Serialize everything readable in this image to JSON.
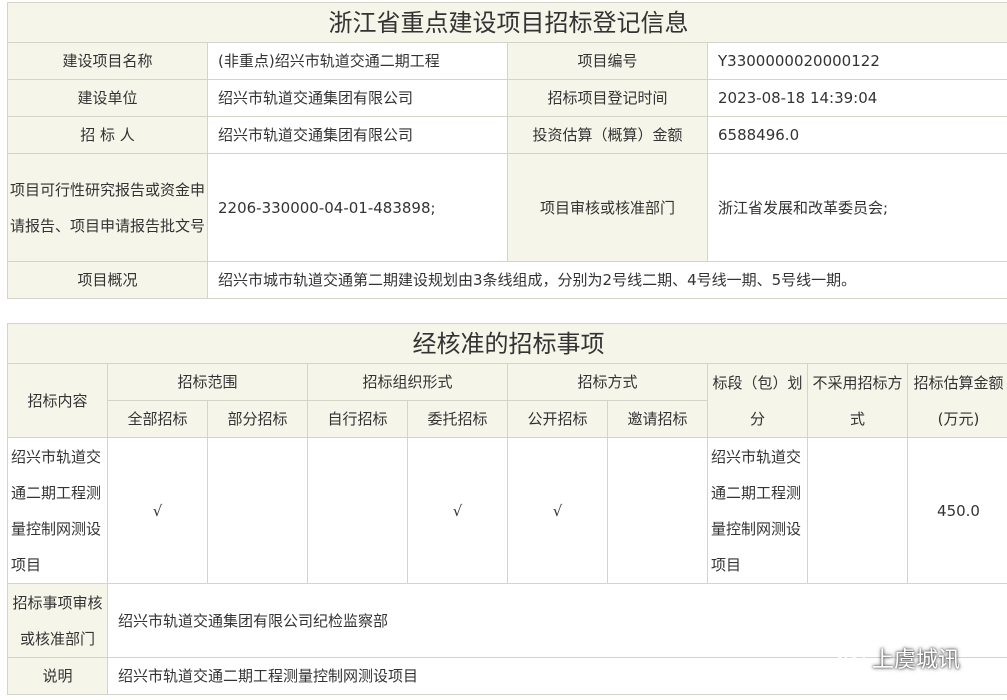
{
  "registration": {
    "title": "浙江省重点建设项目招标登记信息",
    "rows": [
      {
        "label1": "建设项目名称",
        "value1": "(非重点)绍兴市轨道交通二期工程",
        "label2": "项目编号",
        "value2": "Y3300000020000122"
      },
      {
        "label1": "建设单位",
        "value1": "绍兴市轨道交通集团有限公司",
        "label2": "招标项目登记时间",
        "value2": "2023-08-18 14:39:04"
      },
      {
        "label1": "招 标 人",
        "value1": "绍兴市轨道交通集团有限公司",
        "label2": "投资估算（概算）金额",
        "value2": "6588496.0"
      },
      {
        "label1": "项目可行性研究报告或资金申请报告、项目申请报告批文号",
        "value1": "2206-330000-04-01-483898;",
        "label2": "项目审核或核准部门",
        "value2": "浙江省发展和改革委员会;"
      }
    ],
    "overview_label": "项目概况",
    "overview_value": "绍兴市城市轨道交通第二期建设规划由3条线组成，分别为2号线二期、4号线一期、5号线一期。"
  },
  "approved": {
    "title": "经核准的招标事项",
    "headers": {
      "content": "招标内容",
      "scope": "招标范围",
      "scope_all": "全部招标",
      "scope_part": "部分招标",
      "org": "招标组织形式",
      "org_self": "自行招标",
      "org_entrust": "委托招标",
      "method": "招标方式",
      "method_open": "公开招标",
      "method_invite": "邀请招标",
      "section": "标段（包）划分",
      "no_method": "不采用招标方式",
      "estimate": "招标估算金额(万元)"
    },
    "row": {
      "content": "绍兴市轨道交通二期工程测量控制网测设项目",
      "scope_all": "√",
      "scope_part": "",
      "org_self": "",
      "org_entrust": "√",
      "method_open": "√",
      "method_invite": "",
      "section": "绍兴市轨道交通二期工程测量控制网测设项目",
      "no_method": "",
      "estimate": "450.0"
    },
    "review_label": "招标事项审核或核准部门",
    "review_value": "绍兴市轨道交通集团有限公司纪检监察部",
    "note_label": "说明",
    "note_value": "绍兴市轨道交通二期工程测量控制网测设项目"
  },
  "watermark": {
    "text": "上虞城讯",
    "icon": "wechat-icon"
  }
}
